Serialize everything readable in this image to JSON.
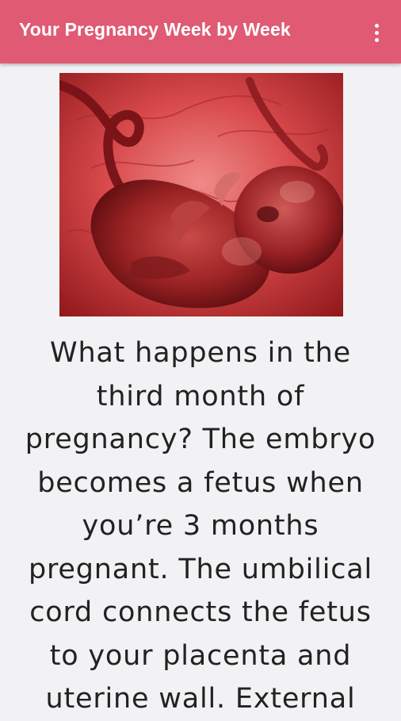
{
  "app_bar": {
    "title": "Your Pregnancy Week by Week",
    "overflow_icon": "more-vert-icon"
  },
  "hero_image": {
    "subject": "fetus-photo"
  },
  "article": {
    "lines": [
      "What happens in the",
      "third month of",
      "pregnancy? The embryo",
      "becomes a fetus when",
      "you’re 3 months",
      "pregnant. The umbilical",
      "cord connects the fetus",
      "to your placenta and",
      "uterine wall. External"
    ]
  },
  "colors": {
    "app_bar": "#e05a74",
    "background": "#f2f1f3",
    "text": "#222222"
  }
}
